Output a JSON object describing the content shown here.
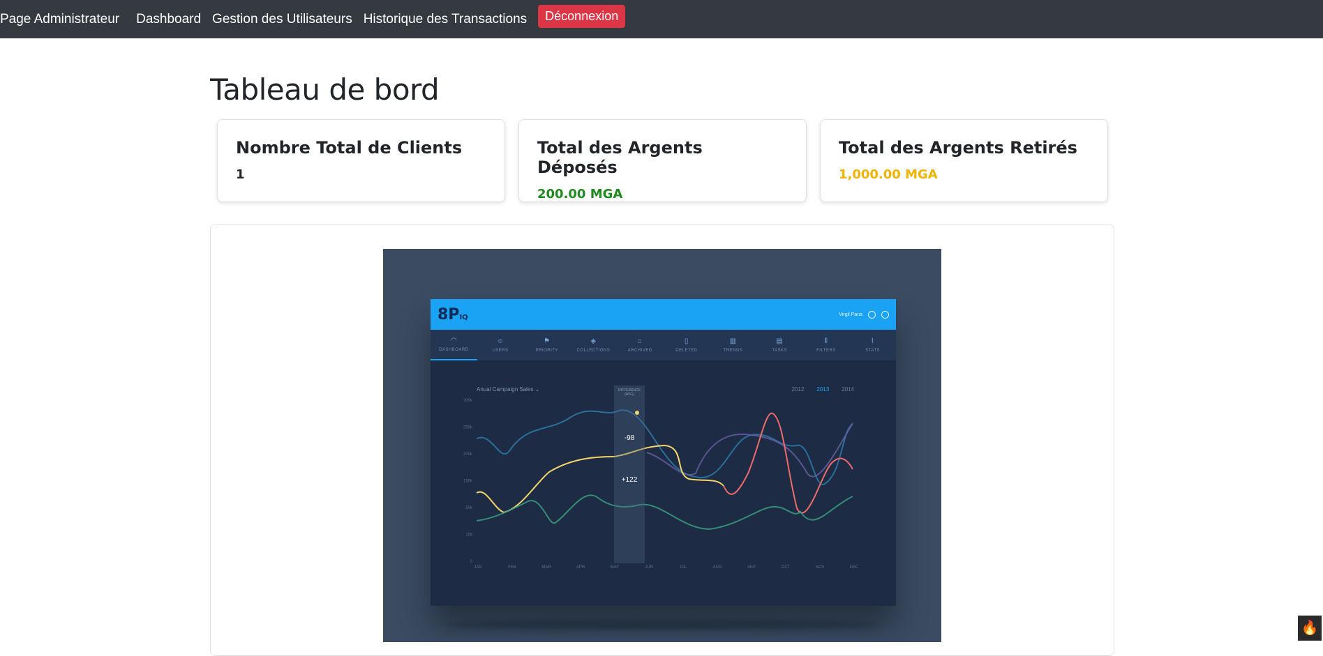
{
  "navbar": {
    "brand": "Page Administrateur",
    "links": [
      "Dashboard",
      "Gestion des Utilisateurs",
      "Historique des Transactions"
    ],
    "logout": "Déconnexion"
  },
  "page": {
    "title": "Tableau de bord"
  },
  "stats": [
    {
      "label": "Nombre Total de Clients",
      "value": "1",
      "color": "#212529"
    },
    {
      "label": "Total des Argents Déposés",
      "value": "200.00 MGA",
      "color": "#1f8a1f"
    },
    {
      "label": "Total des Argents Retirés",
      "value": "1,000.00 MGA",
      "color": "#f0b400"
    }
  ],
  "embedded_image": {
    "user": "Virgil Pana",
    "tabs": [
      "DASHBOARD",
      "USERS",
      "PRIORITY",
      "COLLECTIONS",
      "ARCHIVED",
      "DELETED",
      "TRENDS",
      "TASKS",
      "FILTERS",
      "STATS"
    ],
    "chart_title": "Anual Campaign Sales",
    "years": [
      "2012",
      "2013",
      "2014"
    ],
    "active_year": "2013",
    "difference_label": "DIFFERENCE (AVG)",
    "diff_values": [
      "-98",
      "+122"
    ],
    "y_ticks": [
      "300k",
      "250k",
      "200k",
      "150k",
      "50k",
      "10k",
      "0"
    ],
    "x_ticks": [
      "JAN",
      "FEB",
      "MAR",
      "APR",
      "MAY",
      "JUN",
      "JUL",
      "AUG",
      "SEP",
      "OCT",
      "NOV",
      "DEC"
    ]
  }
}
